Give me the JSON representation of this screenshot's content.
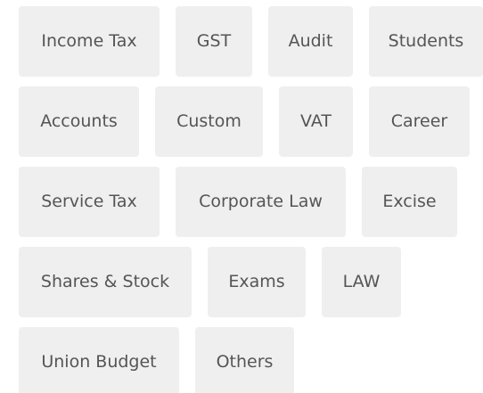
{
  "tags": [
    {
      "label": "Income Tax"
    },
    {
      "label": "GST"
    },
    {
      "label": "Audit"
    },
    {
      "label": "Students"
    },
    {
      "label": "Accounts"
    },
    {
      "label": "Custom"
    },
    {
      "label": "VAT"
    },
    {
      "label": "Career"
    },
    {
      "label": "Service Tax"
    },
    {
      "label": "Corporate Law"
    },
    {
      "label": "Excise"
    },
    {
      "label": "Shares & Stock"
    },
    {
      "label": "Exams"
    },
    {
      "label": "LAW"
    },
    {
      "label": "Union Budget"
    },
    {
      "label": "Others"
    }
  ],
  "colors": {
    "tag_background": "#efefef",
    "tag_text": "#555555",
    "page_background": "#ffffff"
  }
}
